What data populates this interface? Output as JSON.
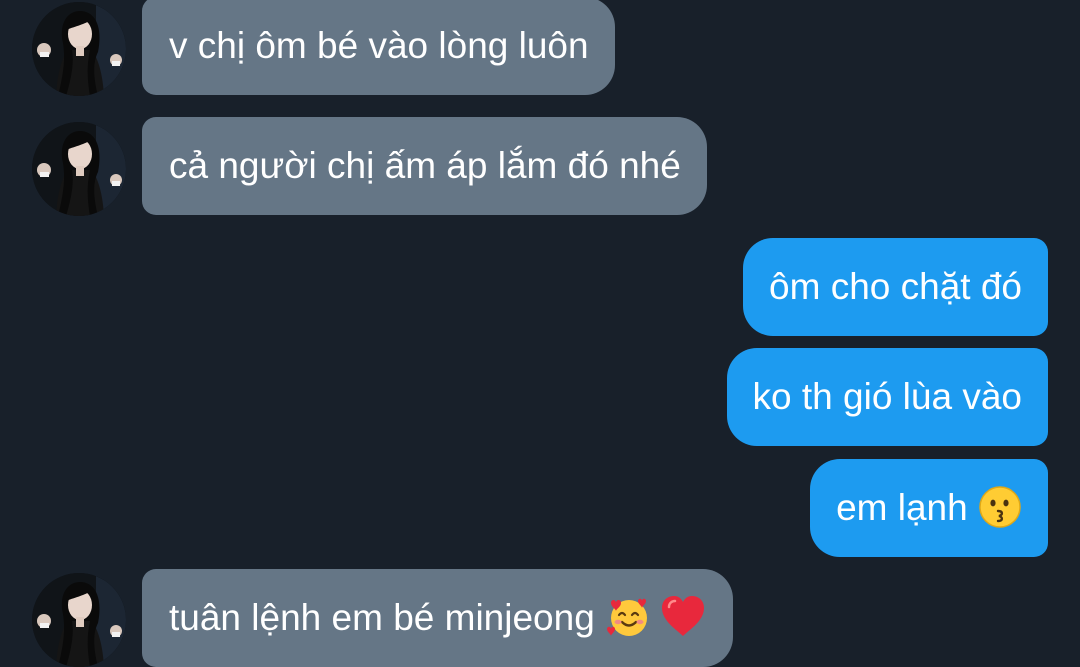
{
  "colors": {
    "background": "#18202a",
    "incoming_bubble": "#657686",
    "outgoing_bubble": "#1d9bf0",
    "text": "#ffffff"
  },
  "messages": [
    {
      "direction": "incoming",
      "text": "v chị ôm bé vào lòng luôn",
      "show_avatar": true
    },
    {
      "direction": "incoming",
      "text": "cả người chị ấm áp lắm đó nhé",
      "show_avatar": true
    },
    {
      "direction": "outgoing",
      "text": "ôm cho chặt đó"
    },
    {
      "direction": "outgoing",
      "text": "ko th gió lùa vào"
    },
    {
      "direction": "outgoing",
      "text": "em lạnh",
      "emoji": [
        "kissing-face-icon"
      ]
    },
    {
      "direction": "incoming",
      "text": "tuân lệnh em bé minjeong",
      "emoji": [
        "smiling-face-with-hearts-icon",
        "red-heart-icon"
      ],
      "show_avatar": true
    }
  ]
}
